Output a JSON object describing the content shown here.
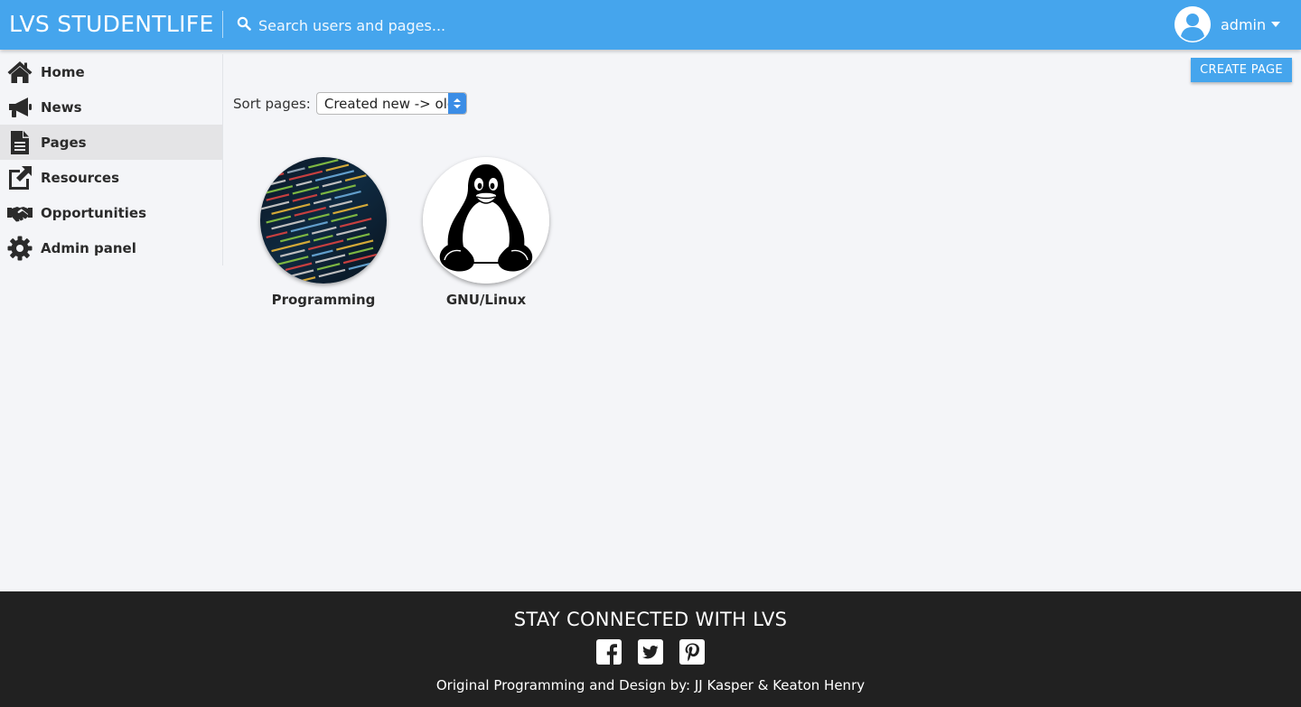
{
  "header": {
    "brand": "LVS STUDENTLIFE",
    "search_placeholder": "Search users and pages...",
    "username": "admin",
    "brand_color": "#45a5ed"
  },
  "sidebar": {
    "items": [
      {
        "label": "Home",
        "icon": "home-icon",
        "active": false
      },
      {
        "label": "News",
        "icon": "megaphone-icon",
        "active": false
      },
      {
        "label": "Pages",
        "icon": "file-icon",
        "active": true
      },
      {
        "label": "Resources",
        "icon": "external-link-icon",
        "active": false
      },
      {
        "label": "Opportunities",
        "icon": "handshake-icon",
        "active": false
      },
      {
        "label": "Admin panel",
        "icon": "gear-icon",
        "active": false
      }
    ]
  },
  "main": {
    "create_button": "CREATE PAGE",
    "sort_label": "Sort pages:",
    "sort_value": "Created new -> old",
    "pages": [
      {
        "title": "Programming",
        "image": "code-screen-image"
      },
      {
        "title": "GNU/Linux",
        "image": "tux-penguin-image"
      }
    ]
  },
  "footer": {
    "heading": "STAY CONNECTED WITH LVS",
    "socials": [
      "facebook-icon",
      "twitter-icon",
      "pinterest-icon"
    ],
    "credits": "Original Programming and Design by: JJ Kasper & Keaton Henry",
    "background": "#212121"
  }
}
